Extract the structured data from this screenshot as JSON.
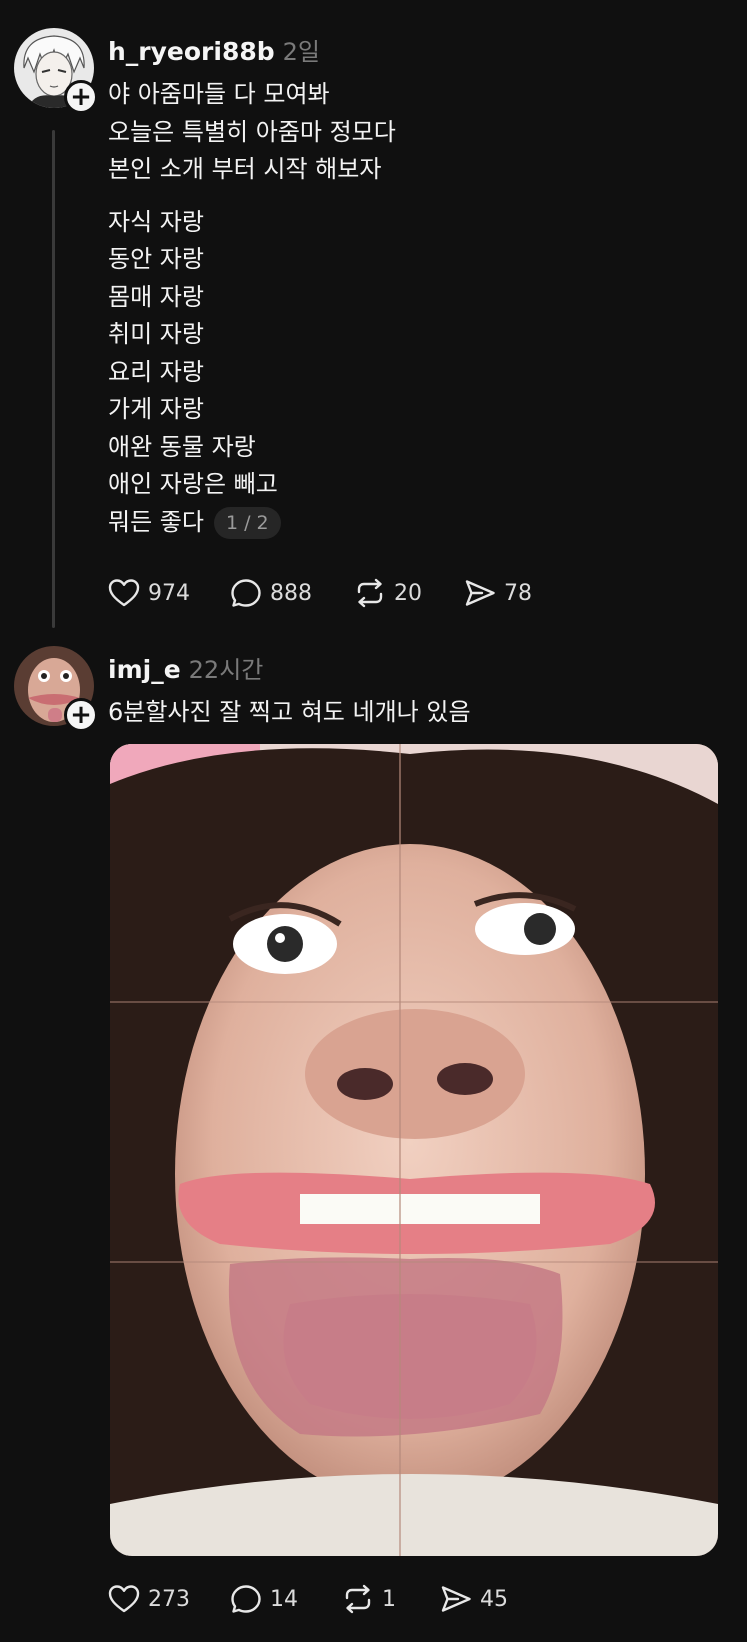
{
  "posts": [
    {
      "username": "h_ryeori88b",
      "time": "2일",
      "paragraphs": [
        [
          "야 아줌마들 다 모여봐",
          "오늘은 특별히 아줌마 정모다",
          "본인 소개 부터 시작 해보자"
        ],
        [
          "자식 자랑",
          "동안 자랑",
          "몸매 자랑",
          "취미 자랑",
          "요리 자랑",
          "가게 자랑",
          "애완 동물 자랑",
          "애인 자랑은 빼고",
          "뭐든 좋다"
        ]
      ],
      "page_indicator": "1 / 2",
      "stats": {
        "likes": "974",
        "comments": "888",
        "reposts": "20",
        "shares": "78"
      }
    },
    {
      "username": "imj_e",
      "time": "22시간",
      "text": "6분할사진 잘 찍고 혀도 네개나 있음",
      "stats": {
        "likes": "273",
        "comments": "14",
        "reposts": "1",
        "shares": "45"
      }
    }
  ],
  "icons": {
    "follow": "plus-icon",
    "like": "heart-icon",
    "comment": "comment-icon",
    "repost": "repost-icon",
    "share": "send-icon"
  },
  "colors": {
    "background": "#101010",
    "text": "#f3f3f3",
    "muted": "#7a7a7a",
    "thread_line": "#3a3a3a"
  }
}
